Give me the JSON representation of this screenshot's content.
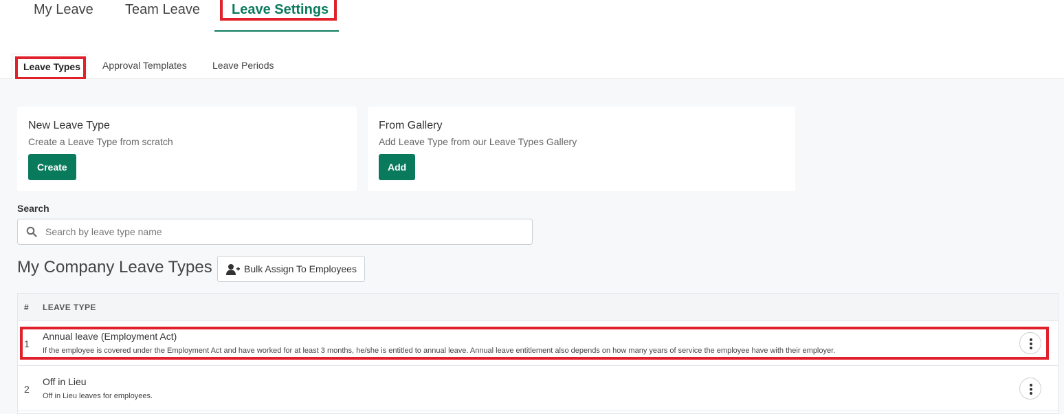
{
  "top_tabs": [
    {
      "label": "My Leave"
    },
    {
      "label": "Team Leave"
    },
    {
      "label": "Leave Settings"
    }
  ],
  "sub_tabs": [
    {
      "label": "Leave Types"
    },
    {
      "label": "Approval Templates"
    },
    {
      "label": "Leave Periods"
    }
  ],
  "cards": {
    "new": {
      "title": "New Leave Type",
      "desc": "Create a Leave Type from scratch",
      "button": "Create"
    },
    "gallery": {
      "title": "From Gallery",
      "desc": "Add Leave Type from our Leave Types Gallery",
      "button": "Add"
    }
  },
  "search": {
    "label": "Search",
    "placeholder": "Search by leave type name",
    "value": ""
  },
  "section": {
    "title": "My Company Leave Types",
    "bulk_button": "Bulk Assign To Employees"
  },
  "table": {
    "headers": {
      "num": "#",
      "type": "LEAVE TYPE"
    },
    "rows": [
      {
        "num": "1",
        "name": "Annual leave (Employment Act)",
        "desc": "If the employee is covered under the Employment Act and have worked for at least 3 months, he/she is entitled to annual leave. Annual leave entitlement also depends on how many years of service the employee have with their employer."
      },
      {
        "num": "2",
        "name": "Off in Lieu",
        "desc": "Off in Lieu leaves for employees."
      }
    ]
  },
  "colors": {
    "accent": "#0a7a5c",
    "highlight": "#e0202a"
  }
}
